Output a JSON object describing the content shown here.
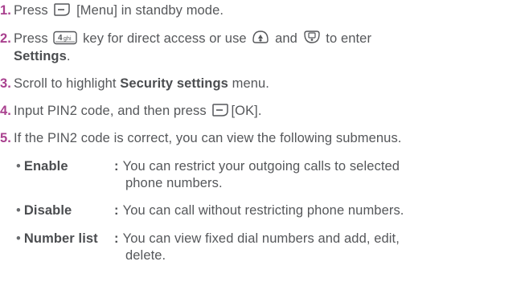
{
  "steps": [
    {
      "number": "1.",
      "pre": "Press",
      "post": "[Menu] in standby mode.",
      "icon": "soft-key-left-icon"
    },
    {
      "number": "2.",
      "pre": "Press",
      "mid": "key for direct access or use",
      "and": "and",
      "post": "to enter",
      "bold_line2": "Settings",
      "end_line2": ".",
      "icons": [
        "key-4ghi-icon",
        "navigation-key-icon",
        "select-key-icon"
      ]
    },
    {
      "number": "3.",
      "pre": "Scroll to highlight",
      "bold": "Security settings",
      "post": "menu."
    },
    {
      "number": "4.",
      "pre": "Input PIN2 code, and then press",
      "post": "[OK].",
      "icon": "soft-key-left-icon"
    },
    {
      "number": "5.",
      "text": "If the PIN2 code is correct, you can view the following submenus."
    }
  ],
  "submenus": [
    {
      "bullet": "•",
      "term": "Enable",
      "colon": ":",
      "desc_line1": "You can restrict your outgoing calls to selected",
      "desc_line2": "phone numbers."
    },
    {
      "bullet": "•",
      "term": "Disable",
      "colon": ":",
      "desc_line1": "You can call without restricting phone numbers."
    },
    {
      "bullet": "•",
      "term": "Number list",
      "colon": ":",
      "desc_line1": "You can view fixed dial numbers and add, edit,",
      "desc_line2": "delete."
    }
  ],
  "key_glyph": {
    "key4_label": "4ghi"
  }
}
